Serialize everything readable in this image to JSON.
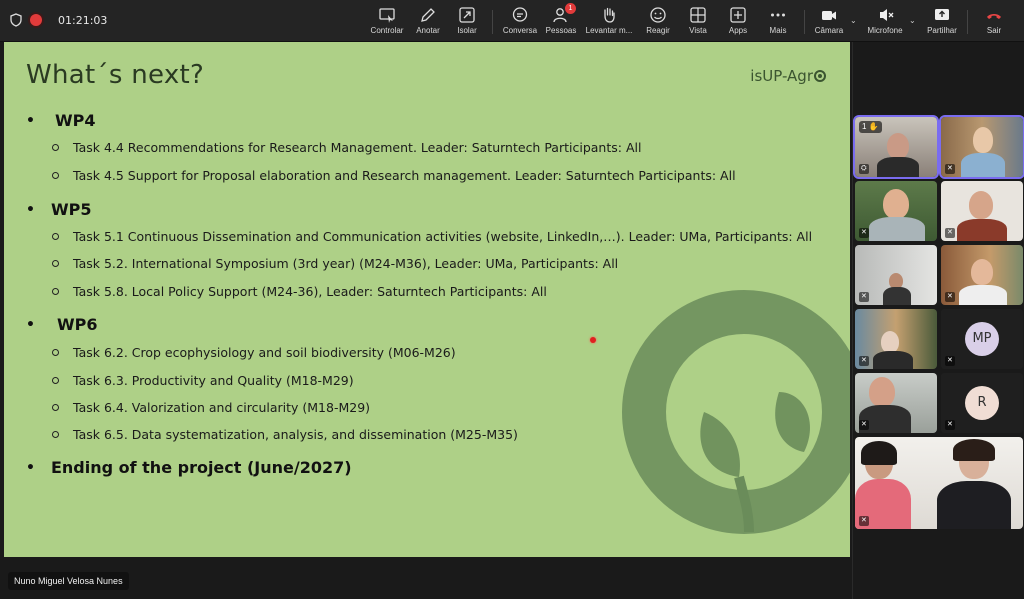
{
  "meeting": {
    "timer": "01:21:03",
    "recording_color": "#e23b3b"
  },
  "toolbar": {
    "buttons": [
      {
        "label": "Controlar",
        "icon": "remote-control-icon"
      },
      {
        "label": "Anotar",
        "icon": "pencil-icon"
      },
      {
        "label": "Isolar",
        "icon": "isolate-icon"
      },
      {
        "label": "Conversa",
        "icon": "chat-icon"
      },
      {
        "label": "Pessoas",
        "icon": "people-icon",
        "badge": "1"
      },
      {
        "label": "Levantar m...",
        "icon": "raise-hand-icon"
      },
      {
        "label": "Reagir",
        "icon": "emoji-icon"
      },
      {
        "label": "Vista",
        "icon": "grid-view-icon"
      },
      {
        "label": "Apps",
        "icon": "apps-icon"
      },
      {
        "label": "Mais",
        "icon": "more-icon"
      },
      {
        "label": "Câmara",
        "icon": "camera-icon"
      },
      {
        "label": "Microfone",
        "icon": "mic-muted-icon"
      },
      {
        "label": "Partilhar",
        "icon": "share-icon"
      },
      {
        "label": "Sair",
        "icon": "leave-icon"
      }
    ]
  },
  "slide": {
    "title": "What´s next?",
    "brand": "isUP-Agr",
    "sections": [
      {
        "heading": "WP4",
        "tasks": [
          "Task 4.4 Recommendations for Research Management. Leader: Saturntech Participants: All",
          "Task 4.5 Support for Proposal elaboration and Research management. Leader: Saturntech Participants: All"
        ]
      },
      {
        "heading": "WP5",
        "tasks": [
          "Task 5.1 Continuous Dissemination and Communication activities (website, LinkedIn,…). Leader: UMa, Participants: All",
          "Task 5.2. International Symposium (3rd year) (M24-M36), Leader: UMa, Participants: All",
          "Task 5.8. Local Policy Support (M24-36), Leader: Saturntech Participants: All"
        ]
      },
      {
        "heading": "WP6",
        "tasks": [
          "Task 6.2. Crop ecophysiology and soil biodiversity (M06-M26)",
          "Task 6.3. Productivity and Quality (M18-M29)",
          "Task 6.4. Valorization and circularity (M18-M29)",
          "Task 6.5. Data systematization, analysis, and dissemination (M25-M35)"
        ]
      }
    ],
    "closing": "Ending of the project (June/2027)",
    "bg_color": "#aed087",
    "accent_color": "#5d7f4c"
  },
  "presenter": {
    "name": "Nuno Miguel Velosa Nunes"
  },
  "participants": [
    {
      "kind": "video",
      "hand": "1 ✋",
      "active": true
    },
    {
      "kind": "video",
      "active": true
    },
    {
      "kind": "video"
    },
    {
      "kind": "video"
    },
    {
      "kind": "video"
    },
    {
      "kind": "video"
    },
    {
      "kind": "video"
    },
    {
      "kind": "initials",
      "initials": "MP"
    },
    {
      "kind": "video"
    },
    {
      "kind": "initials",
      "initials": "R"
    },
    {
      "kind": "video"
    }
  ]
}
